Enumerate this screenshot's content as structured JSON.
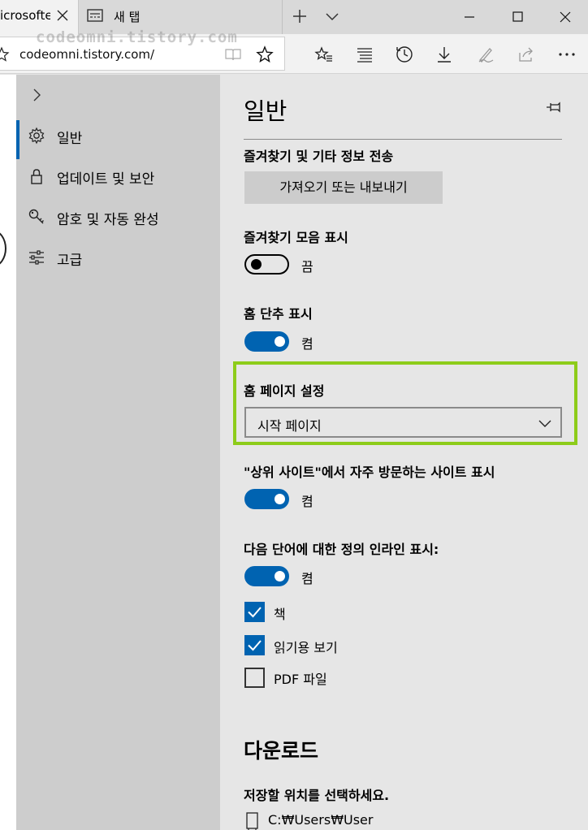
{
  "tabs": [
    {
      "title": "icrosofte",
      "active": true
    },
    {
      "title": "새 탭",
      "active": false
    }
  ],
  "address_bar": {
    "url": "codeomni.tistory.com/"
  },
  "watermark": "codeomni.tistory.com",
  "sidebar": {
    "items": [
      {
        "label": "일반",
        "icon": "gear-icon",
        "active": true
      },
      {
        "label": "업데이트 및 보안",
        "icon": "lock-icon",
        "active": false
      },
      {
        "label": "암호 및 자동 완성",
        "icon": "key-icon",
        "active": false
      },
      {
        "label": "고급",
        "icon": "sliders-icon",
        "active": false
      }
    ]
  },
  "settings": {
    "title": "일반",
    "favorites_transfer": {
      "label": "즐겨찾기 및 기타 정보 전송",
      "button": "가져오기 또는 내보내기"
    },
    "favorites_bar": {
      "label": "즐겨찾기 모음 표시",
      "state": "끔"
    },
    "home_button": {
      "label": "홈 단추 표시",
      "state": "켬"
    },
    "home_page": {
      "label": "홈 페이지 설정",
      "selected": "시작 페이지"
    },
    "top_sites": {
      "label": "\"상위 사이트\"에서 자주 방문하는 사이트 표시",
      "state": "켬"
    },
    "inline_definitions": {
      "label": "다음 단어에 대한 정의 인라인 표시:",
      "state": "켬",
      "options": [
        {
          "label": "책",
          "checked": true
        },
        {
          "label": "읽기용 보기",
          "checked": true
        },
        {
          "label": "PDF 파일",
          "checked": false
        }
      ]
    },
    "downloads": {
      "title": "다운로드",
      "location_label": "저장할 위치를 선택하세요.",
      "path": "C:₩Users₩User"
    }
  },
  "colors": {
    "accent": "#0063b1",
    "highlight": "#8dcc1a",
    "nav_bg": "#cdcdcd",
    "pane_bg": "#e6e6e6"
  }
}
